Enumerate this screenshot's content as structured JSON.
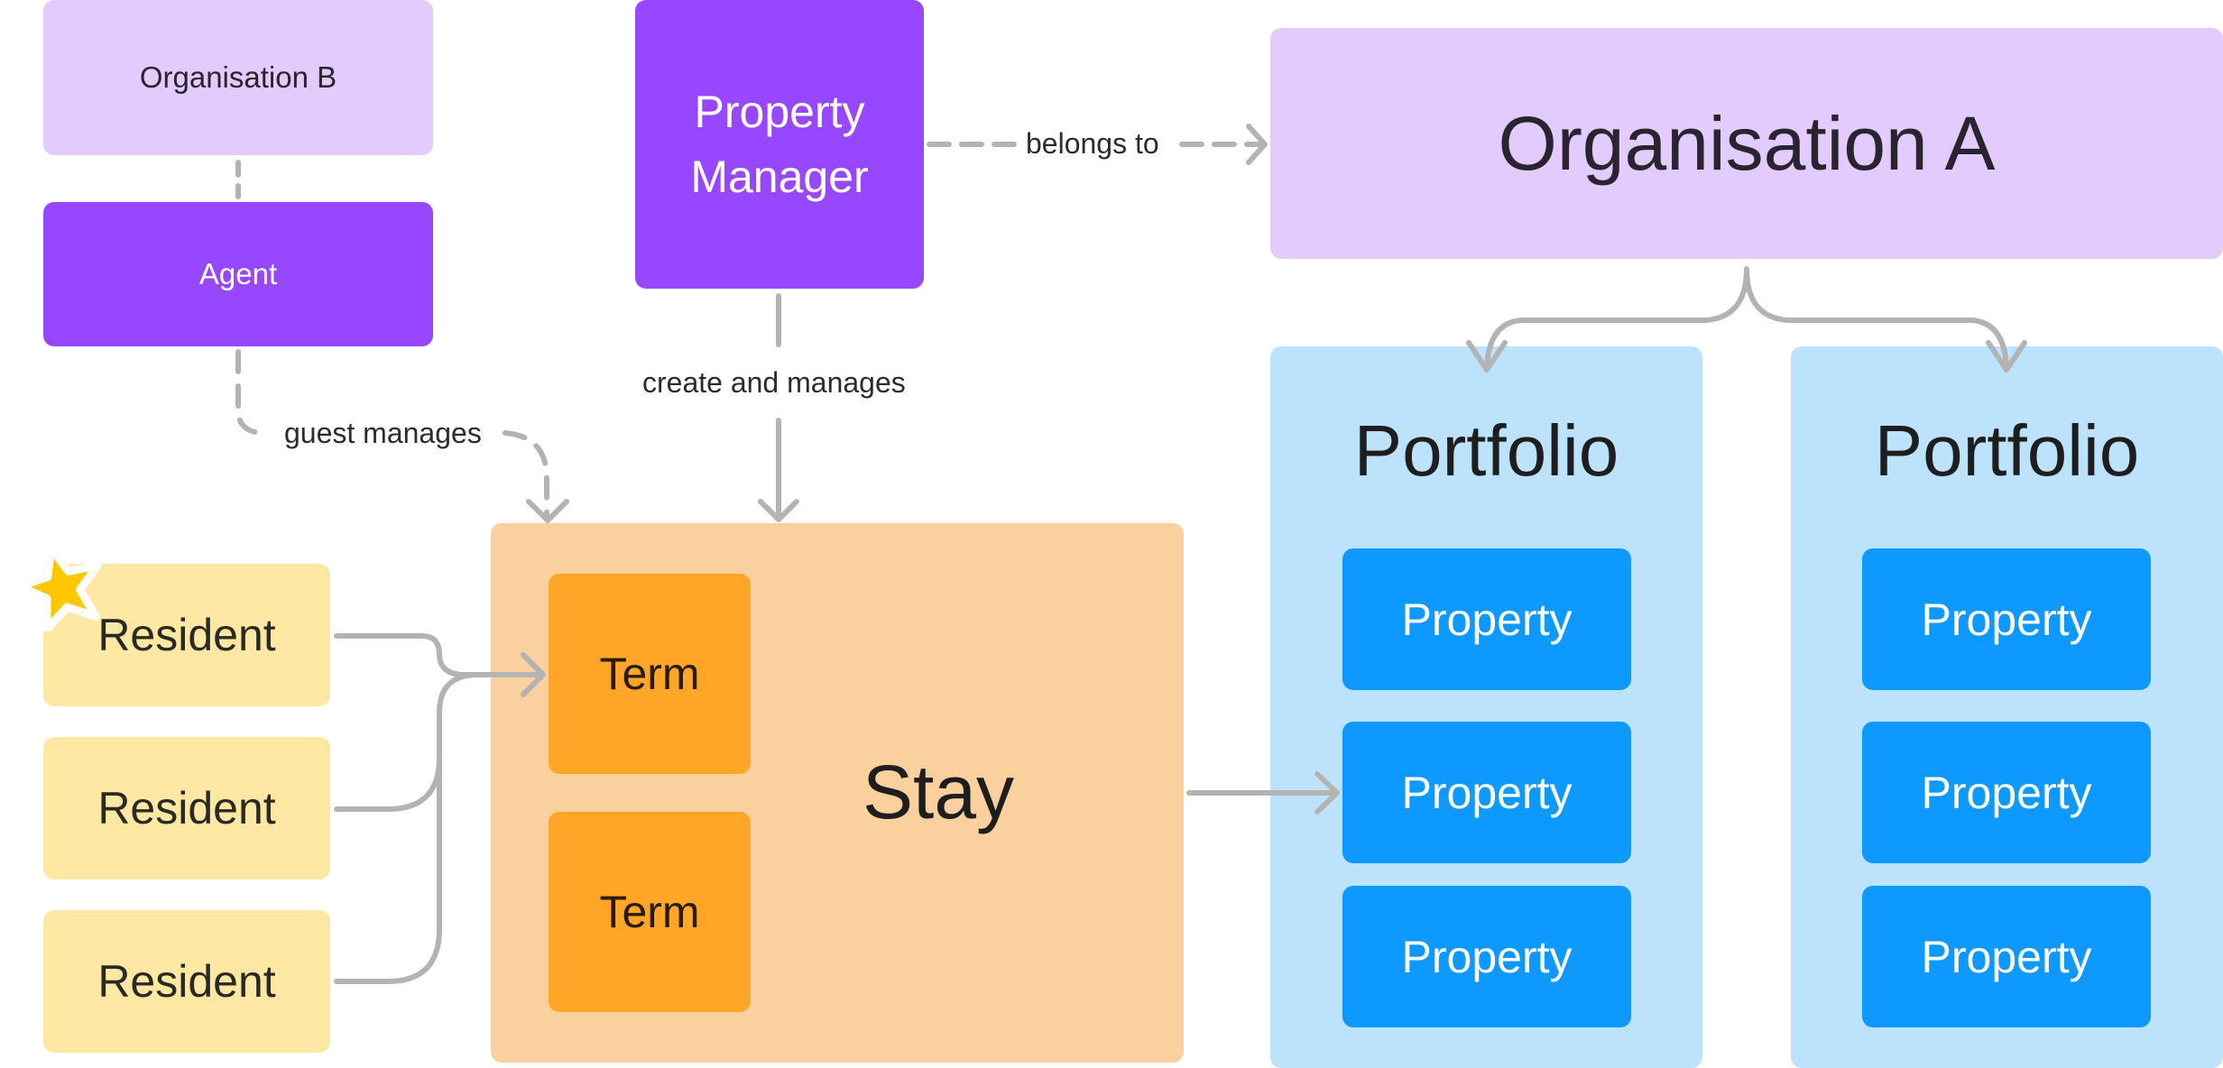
{
  "diagram": {
    "nodes": {
      "organisation_b": "Organisation B",
      "agent": "Agent",
      "property_manager_line1": "Property",
      "property_manager_line2": "Manager",
      "organisation_a": "Organisation A",
      "portfolios": [
        {
          "title": "Portfolio",
          "properties": [
            "Property",
            "Property",
            "Property"
          ]
        },
        {
          "title": "Portfolio",
          "properties": [
            "Property",
            "Property",
            "Property"
          ]
        }
      ],
      "stay": "Stay",
      "terms": [
        "Term",
        "Term"
      ],
      "residents": [
        "Resident",
        "Resident",
        "Resident"
      ]
    },
    "edges": {
      "belongs_to": "belongs to",
      "create_and_manages": "create and manages",
      "guest_manages": "guest manages"
    },
    "badges": {
      "star_icon": "star-icon"
    },
    "colors": {
      "purple_dark": "#9747ff",
      "purple_light": "#e3cbfd",
      "blue_dark": "#0d99ff",
      "blue_light": "#bde3fc",
      "orange_dark": "#ffa629",
      "orange_light": "#fad09e",
      "yellow_light": "#ffe8a3",
      "star": "#ffc700",
      "connector": "#b3b3b3"
    }
  }
}
